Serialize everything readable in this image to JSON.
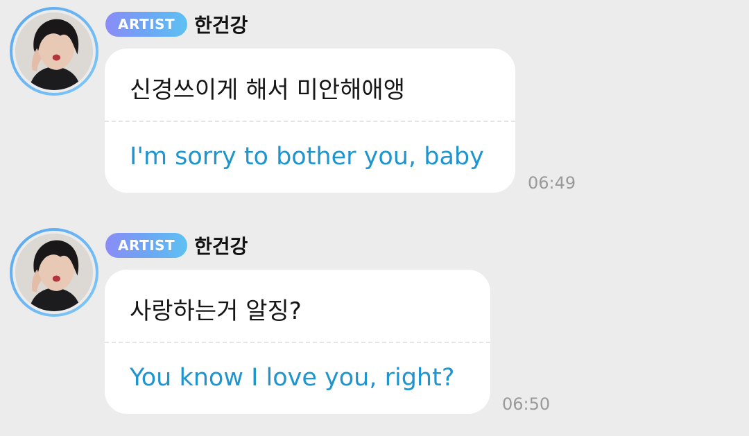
{
  "messages": [
    {
      "badge": "ARTIST",
      "sender": "한건강",
      "original": "신경쓰이게 해서 미안해애앵",
      "translation": "I'm sorry to bother you, baby",
      "time": "06:49"
    },
    {
      "badge": "ARTIST",
      "sender": "한건강",
      "original": "사랑하는거 알징?",
      "translation": "You know I love you, right?",
      "time": "06:50"
    }
  ],
  "colors": {
    "background": "#ececec",
    "bubble": "#ffffff",
    "translation_text": "#1e95cf",
    "timestamp_text": "#999999",
    "badge_gradient_start": "#8a8cf6",
    "badge_gradient_end": "#5ec1f2",
    "avatar_ring": "#5aa7f0"
  }
}
